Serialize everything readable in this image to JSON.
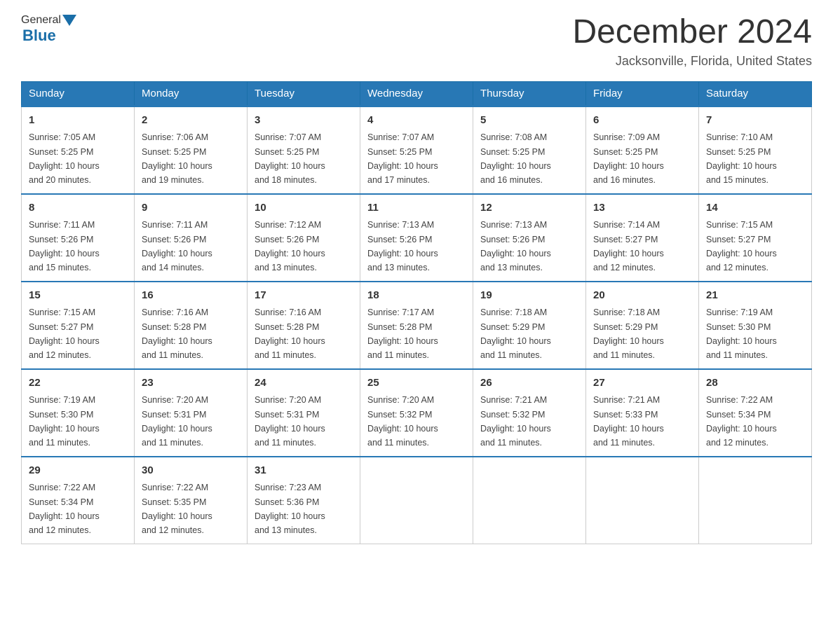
{
  "header": {
    "logo": {
      "general": "General",
      "blue": "Blue"
    },
    "title": "December 2024",
    "location": "Jacksonville, Florida, United States"
  },
  "calendar": {
    "days_of_week": [
      "Sunday",
      "Monday",
      "Tuesday",
      "Wednesday",
      "Thursday",
      "Friday",
      "Saturday"
    ],
    "weeks": [
      [
        {
          "day": "1",
          "sunrise": "7:05 AM",
          "sunset": "5:25 PM",
          "daylight": "10 hours and 20 minutes."
        },
        {
          "day": "2",
          "sunrise": "7:06 AM",
          "sunset": "5:25 PM",
          "daylight": "10 hours and 19 minutes."
        },
        {
          "day": "3",
          "sunrise": "7:07 AM",
          "sunset": "5:25 PM",
          "daylight": "10 hours and 18 minutes."
        },
        {
          "day": "4",
          "sunrise": "7:07 AM",
          "sunset": "5:25 PM",
          "daylight": "10 hours and 17 minutes."
        },
        {
          "day": "5",
          "sunrise": "7:08 AM",
          "sunset": "5:25 PM",
          "daylight": "10 hours and 16 minutes."
        },
        {
          "day": "6",
          "sunrise": "7:09 AM",
          "sunset": "5:25 PM",
          "daylight": "10 hours and 16 minutes."
        },
        {
          "day": "7",
          "sunrise": "7:10 AM",
          "sunset": "5:25 PM",
          "daylight": "10 hours and 15 minutes."
        }
      ],
      [
        {
          "day": "8",
          "sunrise": "7:11 AM",
          "sunset": "5:26 PM",
          "daylight": "10 hours and 15 minutes."
        },
        {
          "day": "9",
          "sunrise": "7:11 AM",
          "sunset": "5:26 PM",
          "daylight": "10 hours and 14 minutes."
        },
        {
          "day": "10",
          "sunrise": "7:12 AM",
          "sunset": "5:26 PM",
          "daylight": "10 hours and 13 minutes."
        },
        {
          "day": "11",
          "sunrise": "7:13 AM",
          "sunset": "5:26 PM",
          "daylight": "10 hours and 13 minutes."
        },
        {
          "day": "12",
          "sunrise": "7:13 AM",
          "sunset": "5:26 PM",
          "daylight": "10 hours and 13 minutes."
        },
        {
          "day": "13",
          "sunrise": "7:14 AM",
          "sunset": "5:27 PM",
          "daylight": "10 hours and 12 minutes."
        },
        {
          "day": "14",
          "sunrise": "7:15 AM",
          "sunset": "5:27 PM",
          "daylight": "10 hours and 12 minutes."
        }
      ],
      [
        {
          "day": "15",
          "sunrise": "7:15 AM",
          "sunset": "5:27 PM",
          "daylight": "10 hours and 12 minutes."
        },
        {
          "day": "16",
          "sunrise": "7:16 AM",
          "sunset": "5:28 PM",
          "daylight": "10 hours and 11 minutes."
        },
        {
          "day": "17",
          "sunrise": "7:16 AM",
          "sunset": "5:28 PM",
          "daylight": "10 hours and 11 minutes."
        },
        {
          "day": "18",
          "sunrise": "7:17 AM",
          "sunset": "5:28 PM",
          "daylight": "10 hours and 11 minutes."
        },
        {
          "day": "19",
          "sunrise": "7:18 AM",
          "sunset": "5:29 PM",
          "daylight": "10 hours and 11 minutes."
        },
        {
          "day": "20",
          "sunrise": "7:18 AM",
          "sunset": "5:29 PM",
          "daylight": "10 hours and 11 minutes."
        },
        {
          "day": "21",
          "sunrise": "7:19 AM",
          "sunset": "5:30 PM",
          "daylight": "10 hours and 11 minutes."
        }
      ],
      [
        {
          "day": "22",
          "sunrise": "7:19 AM",
          "sunset": "5:30 PM",
          "daylight": "10 hours and 11 minutes."
        },
        {
          "day": "23",
          "sunrise": "7:20 AM",
          "sunset": "5:31 PM",
          "daylight": "10 hours and 11 minutes."
        },
        {
          "day": "24",
          "sunrise": "7:20 AM",
          "sunset": "5:31 PM",
          "daylight": "10 hours and 11 minutes."
        },
        {
          "day": "25",
          "sunrise": "7:20 AM",
          "sunset": "5:32 PM",
          "daylight": "10 hours and 11 minutes."
        },
        {
          "day": "26",
          "sunrise": "7:21 AM",
          "sunset": "5:32 PM",
          "daylight": "10 hours and 11 minutes."
        },
        {
          "day": "27",
          "sunrise": "7:21 AM",
          "sunset": "5:33 PM",
          "daylight": "10 hours and 11 minutes."
        },
        {
          "day": "28",
          "sunrise": "7:22 AM",
          "sunset": "5:34 PM",
          "daylight": "10 hours and 12 minutes."
        }
      ],
      [
        {
          "day": "29",
          "sunrise": "7:22 AM",
          "sunset": "5:34 PM",
          "daylight": "10 hours and 12 minutes."
        },
        {
          "day": "30",
          "sunrise": "7:22 AM",
          "sunset": "5:35 PM",
          "daylight": "10 hours and 12 minutes."
        },
        {
          "day": "31",
          "sunrise": "7:23 AM",
          "sunset": "5:36 PM",
          "daylight": "10 hours and 13 minutes."
        },
        null,
        null,
        null,
        null
      ]
    ],
    "labels": {
      "sunrise": "Sunrise:",
      "sunset": "Sunset:",
      "daylight": "Daylight:"
    }
  }
}
